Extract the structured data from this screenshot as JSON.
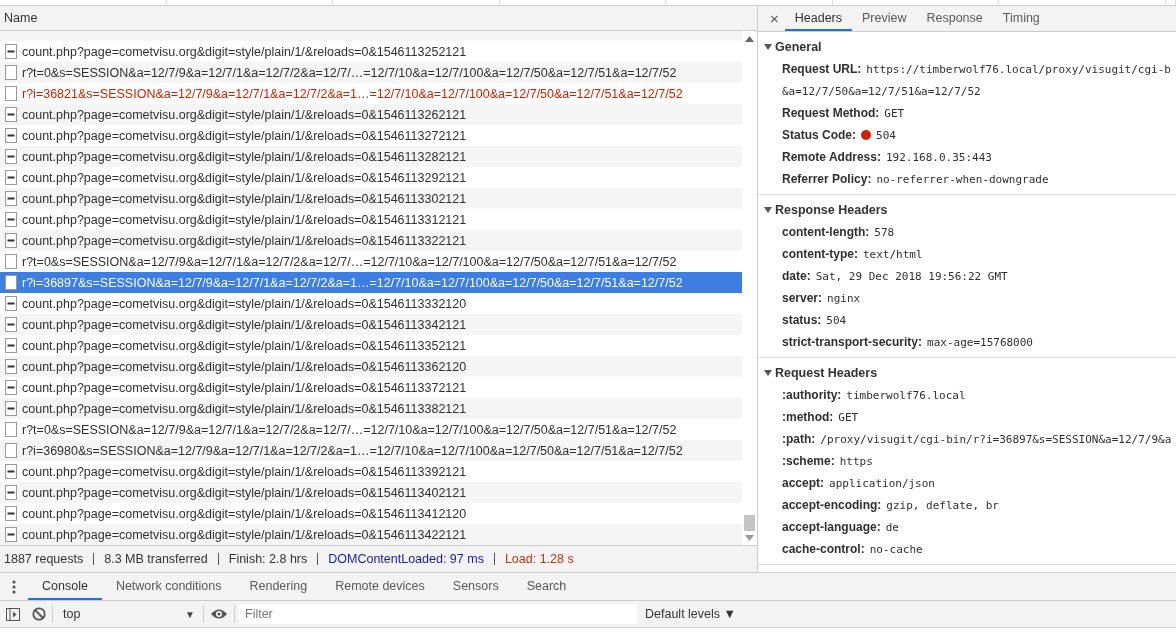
{
  "requests": {
    "column": "Name",
    "rows": [
      {
        "name": "count.php?page=cometvisu.org&digit=style/plain/1/&reloads=0&1546113252121",
        "kind": "counter",
        "failed": false,
        "selected": false
      },
      {
        "name": "r?t=0&s=SESSION&a=12/7/9&a=12/7/1&a=12/7/2&a=12/7/…=12/7/10&a=12/7/100&a=12/7/50&a=12/7/51&a=12/7/52",
        "kind": "request",
        "failed": false,
        "selected": false
      },
      {
        "name": "r?i=36821&s=SESSION&a=12/7/9&a=12/7/1&a=12/7/2&a=1…=12/7/10&a=12/7/100&a=12/7/50&a=12/7/51&a=12/7/52",
        "kind": "request",
        "failed": true,
        "selected": false
      },
      {
        "name": "count.php?page=cometvisu.org&digit=style/plain/1/&reloads=0&1546113262121",
        "kind": "counter",
        "failed": false,
        "selected": false
      },
      {
        "name": "count.php?page=cometvisu.org&digit=style/plain/1/&reloads=0&1546113272121",
        "kind": "counter",
        "failed": false,
        "selected": false
      },
      {
        "name": "count.php?page=cometvisu.org&digit=style/plain/1/&reloads=0&1546113282121",
        "kind": "counter",
        "failed": false,
        "selected": false
      },
      {
        "name": "count.php?page=cometvisu.org&digit=style/plain/1/&reloads=0&1546113292121",
        "kind": "counter",
        "failed": false,
        "selected": false
      },
      {
        "name": "count.php?page=cometvisu.org&digit=style/plain/1/&reloads=0&1546113302121",
        "kind": "counter",
        "failed": false,
        "selected": false
      },
      {
        "name": "count.php?page=cometvisu.org&digit=style/plain/1/&reloads=0&1546113312121",
        "kind": "counter",
        "failed": false,
        "selected": false
      },
      {
        "name": "count.php?page=cometvisu.org&digit=style/plain/1/&reloads=0&1546113322121",
        "kind": "counter",
        "failed": false,
        "selected": false
      },
      {
        "name": "r?t=0&s=SESSION&a=12/7/9&a=12/7/1&a=12/7/2&a=12/7/…=12/7/10&a=12/7/100&a=12/7/50&a=12/7/51&a=12/7/52",
        "kind": "request",
        "failed": false,
        "selected": false
      },
      {
        "name": "r?i=36897&s=SESSION&a=12/7/9&a=12/7/1&a=12/7/2&a=1…=12/7/10&a=12/7/100&a=12/7/50&a=12/7/51&a=12/7/52",
        "kind": "request",
        "failed": false,
        "selected": true
      },
      {
        "name": "count.php?page=cometvisu.org&digit=style/plain/1/&reloads=0&1546113332120",
        "kind": "counter",
        "failed": false,
        "selected": false
      },
      {
        "name": "count.php?page=cometvisu.org&digit=style/plain/1/&reloads=0&1546113342121",
        "kind": "counter",
        "failed": false,
        "selected": false
      },
      {
        "name": "count.php?page=cometvisu.org&digit=style/plain/1/&reloads=0&1546113352121",
        "kind": "counter",
        "failed": false,
        "selected": false
      },
      {
        "name": "count.php?page=cometvisu.org&digit=style/plain/1/&reloads=0&1546113362120",
        "kind": "counter",
        "failed": false,
        "selected": false
      },
      {
        "name": "count.php?page=cometvisu.org&digit=style/plain/1/&reloads=0&1546113372121",
        "kind": "counter",
        "failed": false,
        "selected": false
      },
      {
        "name": "count.php?page=cometvisu.org&digit=style/plain/1/&reloads=0&1546113382121",
        "kind": "counter",
        "failed": false,
        "selected": false
      },
      {
        "name": "r?t=0&s=SESSION&a=12/7/9&a=12/7/1&a=12/7/2&a=12/7/…=12/7/10&a=12/7/100&a=12/7/50&a=12/7/51&a=12/7/52",
        "kind": "request",
        "failed": false,
        "selected": false
      },
      {
        "name": "r?i=36980&s=SESSION&a=12/7/9&a=12/7/1&a=12/7/2&a=1…=12/7/10&a=12/7/100&a=12/7/50&a=12/7/51&a=12/7/52",
        "kind": "request",
        "failed": false,
        "selected": false
      },
      {
        "name": "count.php?page=cometvisu.org&digit=style/plain/1/&reloads=0&1546113392121",
        "kind": "counter",
        "failed": false,
        "selected": false
      },
      {
        "name": "count.php?page=cometvisu.org&digit=style/plain/1/&reloads=0&1546113402121",
        "kind": "counter",
        "failed": false,
        "selected": false
      },
      {
        "name": "count.php?page=cometvisu.org&digit=style/plain/1/&reloads=0&1546113412120",
        "kind": "counter",
        "failed": false,
        "selected": false
      },
      {
        "name": "count.php?page=cometvisu.org&digit=style/plain/1/&reloads=0&1546113422121",
        "kind": "counter",
        "failed": false,
        "selected": false
      }
    ]
  },
  "status_bar": [
    {
      "text": "1887 requests",
      "kind": "plain"
    },
    {
      "text": "8.3 MB transferred",
      "kind": "plain"
    },
    {
      "text": "Finish: 2.8 hrs",
      "kind": "plain"
    },
    {
      "text": "DOMContentLoaded: 97 ms",
      "kind": "dom"
    },
    {
      "text": "Load: 1.28 s",
      "kind": "load"
    }
  ],
  "details": {
    "close": "×",
    "tabs": [
      {
        "label": "Headers",
        "selected": true
      },
      {
        "label": "Preview",
        "selected": false
      },
      {
        "label": "Response",
        "selected": false
      },
      {
        "label": "Timing",
        "selected": false
      }
    ],
    "sections": [
      {
        "title": "General",
        "expanded": true,
        "items": [
          {
            "name": "Request URL:",
            "value": "https://timberwolf76.local/proxy/visugit/cgi-b",
            "continuation": "&a=12/7/50&a=12/7/51&a=12/7/52"
          },
          {
            "name": "Request Method:",
            "value": "GET"
          },
          {
            "name": "Status Code:",
            "value": "504",
            "color": "#cc2200"
          },
          {
            "name": "Remote Address:",
            "value": "192.168.0.35:443"
          },
          {
            "name": "Referrer Policy:",
            "value": "no-referrer-when-downgrade"
          }
        ]
      },
      {
        "title": "Response Headers",
        "expanded": true,
        "items": [
          {
            "name": "content-length:",
            "value": "578"
          },
          {
            "name": "content-type:",
            "value": "text/html"
          },
          {
            "name": "date:",
            "value": "Sat, 29 Dec 2018 19:56:22 GMT"
          },
          {
            "name": "server:",
            "value": "nginx"
          },
          {
            "name": "status:",
            "value": "504"
          },
          {
            "name": "strict-transport-security:",
            "value": "max-age=15768000"
          }
        ]
      },
      {
        "title": "Request Headers",
        "expanded": true,
        "items": [
          {
            "name": ":authority:",
            "value": "timberwolf76.local"
          },
          {
            "name": ":method:",
            "value": "GET"
          },
          {
            "name": ":path:",
            "value": "/proxy/visugit/cgi-bin/r?i=36897&s=SESSION&a=12/7/9&a"
          },
          {
            "name": ":scheme:",
            "value": "https"
          },
          {
            "name": "accept:",
            "value": "application/json"
          },
          {
            "name": "accept-encoding:",
            "value": "gzip, deflate, br"
          },
          {
            "name": "accept-language:",
            "value": "de"
          },
          {
            "name": "cache-control:",
            "value": "no-cache"
          }
        ]
      }
    ]
  },
  "drawer": {
    "tabs": [
      {
        "label": "Console",
        "selected": true
      },
      {
        "label": "Network conditions",
        "selected": false
      },
      {
        "label": "Rendering",
        "selected": false
      },
      {
        "label": "Remote devices",
        "selected": false
      },
      {
        "label": "Sensors",
        "selected": false
      },
      {
        "label": "Search",
        "selected": false
      }
    ],
    "context": "top",
    "filter": {
      "placeholder": "Filter"
    },
    "levels": "Default levels ▼",
    "context_caret": "▼"
  }
}
